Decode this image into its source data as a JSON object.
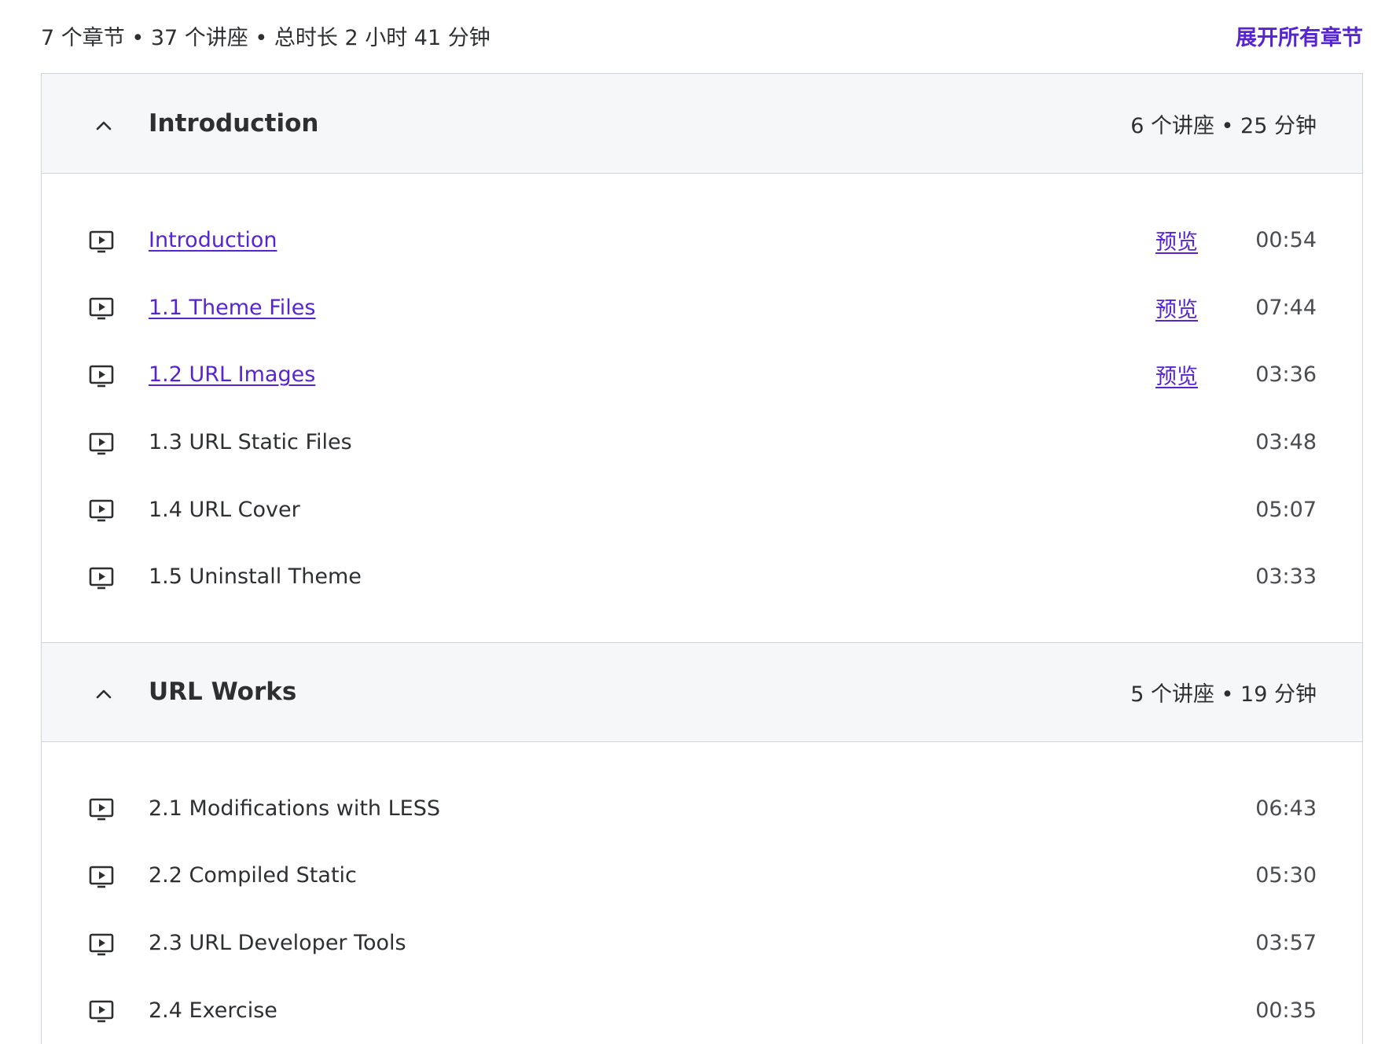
{
  "summary": {
    "text": "7 个章节 • 37 个讲座 • 总时长 2 小时 41 分钟",
    "expand_all": "展开所有章节"
  },
  "sections": [
    {
      "title": "Introduction",
      "meta": "6 个讲座 • 25 分钟",
      "lectures": [
        {
          "title": "Introduction",
          "preview": "预览",
          "duration": "00:54"
        },
        {
          "title": "1.1 Theme Files",
          "preview": "预览",
          "duration": "07:44"
        },
        {
          "title": "1.2 URL Images",
          "preview": "预览",
          "duration": "03:36"
        },
        {
          "title": "1.3 URL Static Files",
          "duration": "03:48"
        },
        {
          "title": "1.4 URL Cover",
          "duration": "05:07"
        },
        {
          "title": "1.5 Uninstall Theme",
          "duration": "03:33"
        }
      ]
    },
    {
      "title": "URL Works",
      "meta": "5 个讲座 • 19 分钟",
      "lectures": [
        {
          "title": "2.1 Modifications with LESS",
          "duration": "06:43"
        },
        {
          "title": "2.2 Compiled Static",
          "duration": "05:30"
        },
        {
          "title": "2.3 URL Developer Tools",
          "duration": "03:57"
        },
        {
          "title": "2.4 Exercise",
          "duration": "00:35"
        }
      ]
    }
  ],
  "icons": {
    "chevron": "chevron-up-icon",
    "lecture": "video-play-icon"
  },
  "colors": {
    "link": "#5624d0",
    "header_bg": "#f6f7f9",
    "border": "#d1d2e0",
    "text": "#2d2f31"
  }
}
